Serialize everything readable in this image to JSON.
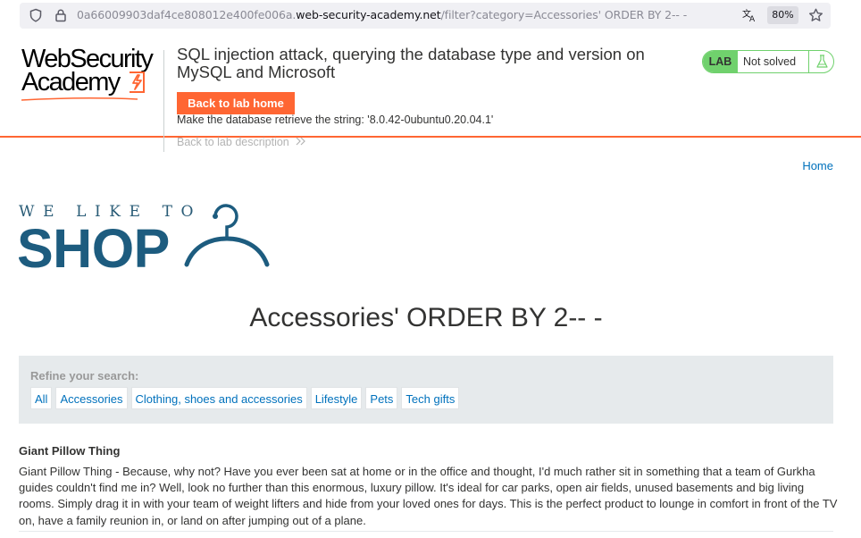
{
  "browser": {
    "url_prefix": "0a66009903daf4ce808012e400fe006a.",
    "url_host": "web-security-academy.net",
    "url_path": "/filter?category=Accessories' ORDER BY 2-- -",
    "zoom": "80%",
    "icons": [
      "shield-icon",
      "lock-icon",
      "translate-icon",
      "star-icon"
    ]
  },
  "header": {
    "logo_line1": "WebSecurity",
    "logo_line2": "Academy",
    "title": "SQL injection attack, querying the database type and version on MySQL and Microsoft",
    "back_button": "Back to lab home",
    "description": "Make the database retrieve the string: '8.0.42-0ubuntu0.20.04.1'",
    "back_description": "Back to lab description",
    "badge_label": "LAB",
    "badge_status": "Not solved",
    "accent_color": "#ff6633",
    "status_color": "#70d16d"
  },
  "nav": {
    "home": "Home"
  },
  "shop_logo": {
    "tagline": "WE LIKE TO",
    "word": "SHOP"
  },
  "main": {
    "title": "Accessories' ORDER BY 2-- -",
    "filter_label": "Refine your search:",
    "categories": [
      "All",
      "Accessories",
      "Clothing, shoes and accessories",
      "Lifestyle",
      "Pets",
      "Tech gifts"
    ]
  },
  "product": {
    "name": "Giant Pillow Thing",
    "description": "Giant Pillow Thing - Because, why not? Have you ever been sat at home or in the office and thought, I'd much rather sit in something that a team of Gurkha guides couldn't find me in? Well, look no further than this enormous, luxury pillow. It's ideal for car parks, open air fields, unused basements and big living rooms. Simply drag it in with your team of weight lifters and hide from your loved ones for days. This is the perfect product to lounge in comfort in front of the TV on, have a family reunion in, or land on after jumping out of a plane."
  }
}
